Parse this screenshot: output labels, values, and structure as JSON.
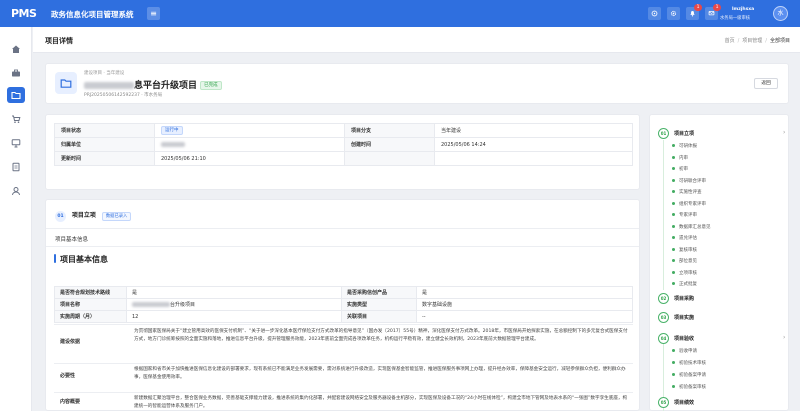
{
  "app": {
    "logo": "PMS",
    "title": "政务信息化项目管理系统",
    "notifications": [
      {
        "count": "1"
      },
      {
        "count": "1"
      }
    ]
  },
  "user": {
    "name": "lmzjhsxa",
    "role": "水务局一级审核",
    "avatar_text": "水"
  },
  "page": {
    "title": "项目详情",
    "breadcrumb": [
      "首页",
      "项目管理",
      "全部项目"
    ]
  },
  "project": {
    "subtitle": "建设项目 · 当年建设",
    "title_suffix": "息平台升级项目",
    "status": "已完成",
    "meta": "PRJ20250506142592237 · 市水务局",
    "back_label": "返回"
  },
  "info": {
    "status_label": "项目状态",
    "status_value": "运行中",
    "category_label": "项目分支",
    "category_value": "当年建设",
    "unit_label": "归属单位",
    "created_label": "创建时间",
    "created_value": "2025/05/06 14:24",
    "updated_label": "更新时间",
    "updated_value": "2025/05/06 21:10"
  },
  "section": {
    "num": "01",
    "title": "项目立项",
    "tag": "数据已录入",
    "sub": "项目基本信息",
    "heading": "项目基本信息"
  },
  "basic": {
    "r1_k1": "是否符合规划技术路线",
    "r1_v1": "是",
    "r1_k2": "是否采购信创产品",
    "r1_v2": "是",
    "r2_k1": "项目名称",
    "r2_v1": "台升级项目",
    "r2_k2": "实施类型",
    "r2_v2": "数字基础设施",
    "r3_k1": "实施周期（月）",
    "r3_v1": "12",
    "r3_k2": "关联项目",
    "r3_v2": "--",
    "basis_label": "建设依据",
    "basis_text": "为贯彻国家医保局关于“建立管用高效的医保支付机制”、“关于进一步深化基本医疗保险支付方式改革的指导意见”（国办发〔2017〕55号）精神，深化医保支付方式改革。2018年，市医保局开始探索实施，在总额控制下的多元复合式医保支付方式，地方门诊统筹按照的全面实施和落地，推进信息平台升级，提升管理服务效能，2023年底前全面完成各项改革任务，机构运行平稳有效，建立健全长效机制，2023年底前大数据管理平台建成。",
    "need_label": "必要性",
    "need_text": "根据国家和省市关于加快推进医保信息化建设的部署要求，现有系统已不能满足业务发展需要，需对系统进行升级改造，实现医保基金智能监管，推进医保服务事项网上办理，提升经办效率，保障基金安全运行，减轻参保群众负担，便利群众办事，医保基金使用效率。",
    "content_label": "内容概要",
    "content_text": "新建数据汇聚治理平台，整合医保业务数据，完善基础支撑能力建设，推进系统的集约化部署，并配套建设网络安全及服务器设备主机部分，实现医保及设备工况的“24小时在线体检”，构建全市地下管网及地表水系的“一张图”数字孪生底座，构建统一的智能运营体系及服务门户。"
  },
  "timeline": {
    "stages": [
      {
        "num": "01",
        "label": "项目立项",
        "subs": [
          "可研体报",
          "内审",
          "初审",
          "可研联合评审",
          "实施性评查",
          "组织专家评审",
          "专家评审",
          "数据库汇总意见",
          "遗兑评估",
          "复核审核",
          "部位意见",
          "立项审核",
          "正式批复"
        ]
      },
      {
        "num": "02",
        "label": "项目采购",
        "subs": []
      },
      {
        "num": "03",
        "label": "项目实施",
        "subs": []
      },
      {
        "num": "04",
        "label": "项目验收",
        "subs": [
          "验收申请",
          "初验技术审核",
          "初验备案申请",
          "初验备案审核"
        ]
      },
      {
        "num": "05",
        "label": "项目绩效",
        "subs": []
      }
    ]
  },
  "colors": {
    "primary": "#2f6fdf",
    "success": "#2fa24a",
    "background": "#eef0f4"
  },
  "icons": [
    "menu-icon",
    "fullscreen-icon",
    "settings-icon",
    "bell-icon",
    "message-icon",
    "folder-icon",
    "home-icon",
    "toolbox-icon",
    "cart-icon",
    "monitor-icon",
    "document-icon",
    "user-icon"
  ]
}
